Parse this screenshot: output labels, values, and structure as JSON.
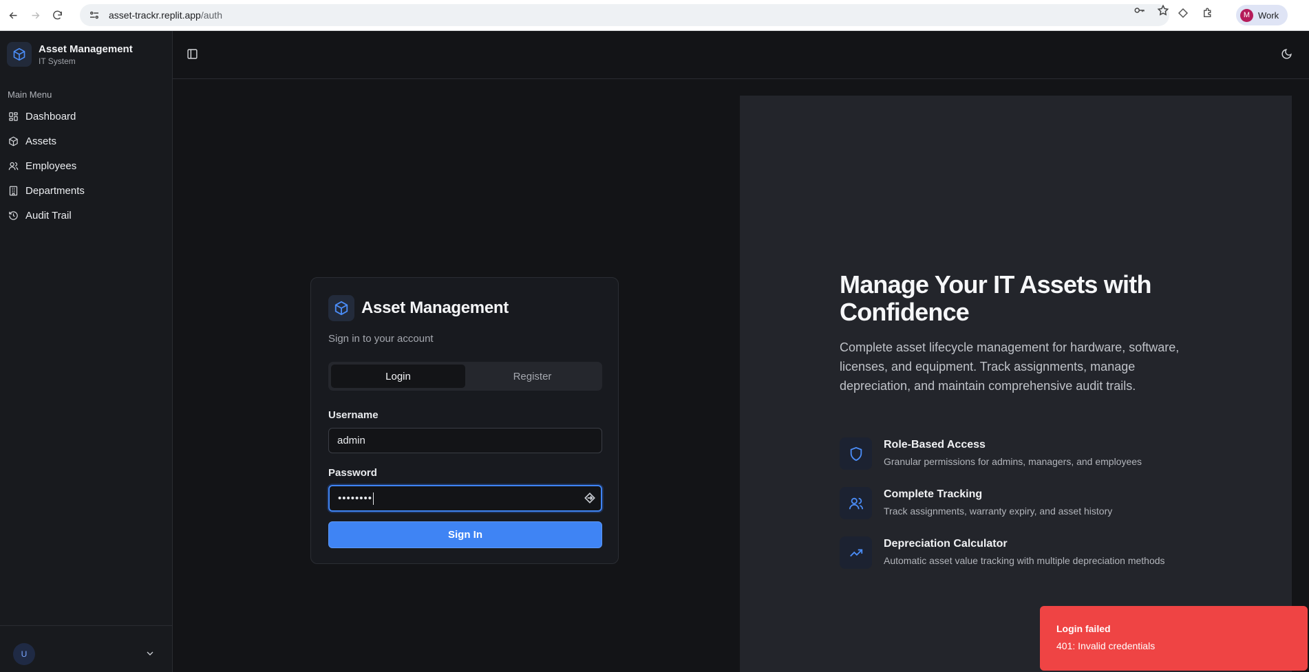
{
  "browser": {
    "url_host": "asset-trackr.replit.app",
    "url_path": "/auth",
    "profile_initial": "M",
    "profile_label": "Work"
  },
  "sidebar": {
    "app_title": "Asset Management",
    "app_subtitle": "IT System",
    "section_label": "Main Menu",
    "items": [
      {
        "label": "Dashboard",
        "icon": "dashboard-icon"
      },
      {
        "label": "Assets",
        "icon": "box-icon"
      },
      {
        "label": "Employees",
        "icon": "users-icon"
      },
      {
        "label": "Departments",
        "icon": "building-icon"
      },
      {
        "label": "Audit Trail",
        "icon": "history-icon"
      }
    ],
    "user_initial": "U"
  },
  "login": {
    "title": "Asset Management",
    "subtitle": "Sign in to your account",
    "tabs": [
      "Login",
      "Register"
    ],
    "active_tab": "Login",
    "username_label": "Username",
    "username_value": "admin",
    "password_label": "Password",
    "password_value": "••••••••",
    "submit_label": "Sign In"
  },
  "hero": {
    "title": "Manage Your IT Assets with Confidence",
    "description": "Complete asset lifecycle management for hardware, software, licenses, and equipment. Track assignments, manage depreciation, and maintain comprehensive audit trails.",
    "features": [
      {
        "title": "Role-Based Access",
        "description": "Granular permissions for admins, managers, and employees",
        "icon": "shield-icon"
      },
      {
        "title": "Complete Tracking",
        "description": "Track assignments, warranty expiry, and asset history",
        "icon": "users-icon"
      },
      {
        "title": "Depreciation Calculator",
        "description": "Automatic asset value tracking with multiple depreciation methods",
        "icon": "trending-up-icon"
      }
    ]
  },
  "toast": {
    "title": "Login failed",
    "message": "401: Invalid credentials"
  },
  "colors": {
    "accent": "#3f84f4",
    "error": "#ef4444",
    "background": "#131417",
    "sidebar": "#181a1e",
    "panel": "#23252b"
  }
}
